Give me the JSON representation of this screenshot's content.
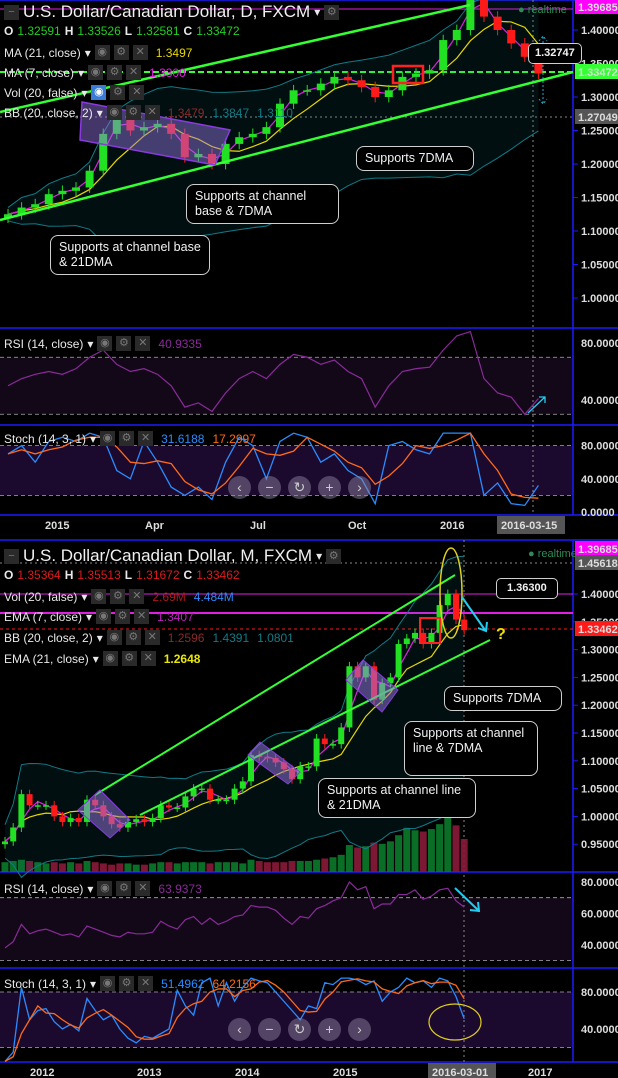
{
  "colors": {
    "up": "#22e022",
    "down": "#ff1a1a",
    "ma21": "#e8d800",
    "ma7": "#e020e0",
    "bb": "#117a86",
    "channel": "#33ff33",
    "axis": "#1a1aff",
    "rsi": "#8a2a9a",
    "stoch_k": "#2a8cff",
    "stoch_d": "#ff6a1a",
    "arrow": "#22ccee"
  },
  "daily": {
    "title": "U.S. Dollar/Canadian Dollar, D, FXCM",
    "ohlc": {
      "o": "1.32591",
      "h": "1.33526",
      "l": "1.32581",
      "c": "1.33472"
    },
    "legend": {
      "ma21": {
        "label": "MA (21, close)",
        "value": "1.3497"
      },
      "ma7": {
        "label": "MA (7, close)",
        "value": "1.3300"
      },
      "vol": {
        "label": "Vol (20, false)"
      },
      "bb": {
        "label": "BB (20, close, 2)",
        "v1": "1.3479",
        "v2": "1.3847",
        "v3": "1.3110"
      },
      "rsi": {
        "label": "RSI (14, close)",
        "value": "40.9335"
      },
      "stoch": {
        "label": "Stoch (14, 3, 1)",
        "k": "31.6188",
        "d": "17.2997"
      }
    },
    "realtime": "realtime",
    "price_axis": [
      "1.40000",
      "1.35000",
      "1.30000",
      "1.25000",
      "1.20000",
      "1.15000",
      "1.10000",
      "1.05000",
      "1.00000"
    ],
    "price_tags": {
      "high": "1.39685",
      "last": "1.33472",
      "cross": "1.27049",
      "callout": "1.32747"
    },
    "rsi_axis": [
      "80.0000",
      "40.0000"
    ],
    "stoch_axis": [
      "80.0000",
      "40.0000",
      "0.0000"
    ],
    "time_axis": [
      "2015",
      "Apr",
      "Jul",
      "Oct",
      "2016"
    ],
    "cursor_date": "2016-03-15",
    "annotations": [
      "Supports at channel base & 21DMA",
      "Supports at channel base & 7DMA",
      "Supports 7DMA"
    ],
    "chart_data": {
      "type": "candlestick",
      "closes": [
        1.125,
        1.135,
        1.14,
        1.155,
        1.16,
        1.165,
        1.19,
        1.245,
        1.27,
        1.25,
        1.255,
        1.26,
        1.245,
        1.21,
        1.215,
        1.2,
        1.23,
        1.24,
        1.245,
        1.255,
        1.29,
        1.31,
        1.31,
        1.32,
        1.33,
        1.325,
        1.315,
        1.3,
        1.31,
        1.33,
        1.335,
        1.34,
        1.385,
        1.4,
        1.46,
        1.42,
        1.4,
        1.38,
        1.36,
        1.335
      ],
      "rsi": [
        50,
        55,
        58,
        60,
        58,
        62,
        70,
        75,
        65,
        60,
        62,
        58,
        50,
        35,
        38,
        32,
        45,
        55,
        60,
        55,
        65,
        72,
        70,
        65,
        68,
        60,
        55,
        35,
        50,
        60,
        62,
        63,
        75,
        85,
        88,
        55,
        45,
        42,
        30,
        41
      ],
      "stoch_k": [
        70,
        80,
        60,
        85,
        90,
        85,
        95,
        90,
        50,
        40,
        85,
        60,
        30,
        20,
        30,
        15,
        60,
        90,
        80,
        40,
        85,
        95,
        90,
        60,
        70,
        50,
        40,
        10,
        80,
        85,
        75,
        70,
        95,
        95,
        95,
        20,
        35,
        10,
        8,
        32
      ],
      "ylim": [
        0.97,
        1.45
      ]
    }
  },
  "monthly": {
    "title": "U.S. Dollar/Canadian Dollar, M, FXCM",
    "ohlc": {
      "o": "1.35364",
      "h": "1.35513",
      "l": "1.31672",
      "c": "1.33462"
    },
    "legend": {
      "vol": {
        "label": "Vol (20, false)",
        "v1": "2.69M",
        "v2": "4.484M"
      },
      "ema7": {
        "label": "EMA (7, close)",
        "value": "1.3407"
      },
      "bb": {
        "label": "BB (20, close, 2)",
        "v1": "1.2596",
        "v2": "1.4391",
        "v3": "1.0801"
      },
      "ema21": {
        "label": "EMA (21, close)",
        "value": "1.2648"
      },
      "rsi": {
        "label": "RSI (14, close)",
        "value": "63.9373"
      },
      "stoch": {
        "label": "Stoch (14, 3, 1)",
        "k": "51.4962",
        "d": "64.2156"
      }
    },
    "realtime": "realtime",
    "price_axis": [
      "1.40000",
      "1.35000",
      "1.30000",
      "1.25000",
      "1.20000",
      "1.15000",
      "1.10000",
      "1.05000",
      "1.00000",
      "0.95000"
    ],
    "price_tags": {
      "high": "1.39685",
      "cross": "1.45618",
      "last": "1.33462",
      "callout": "1.36300"
    },
    "rsi_axis": [
      "80.0000",
      "60.0000",
      "40.0000"
    ],
    "stoch_axis": [
      "80.0000",
      "40.0000"
    ],
    "time_axis": [
      "2012",
      "2013",
      "2014",
      "2015",
      "2017"
    ],
    "cursor_date": "2016-03-01",
    "question": "?",
    "annotations": [
      "Supports 7DMA",
      "Supports at channel line & 7DMA",
      "Supports at channel line & 21DMA"
    ],
    "chart_data": {
      "type": "candlestick",
      "closes": [
        0.955,
        0.98,
        1.04,
        1.02,
        1.02,
        1.02,
        1.0,
        0.99,
        0.997,
        0.99,
        1.03,
        1.02,
        1.0,
        0.986,
        0.98,
        0.99,
        0.995,
        0.99,
        0.997,
        1.02,
        1.016,
        1.016,
        1.036,
        1.05,
        1.05,
        1.03,
        1.03,
        1.03,
        1.05,
        1.063,
        1.11,
        1.107,
        1.105,
        1.097,
        1.085,
        1.067,
        1.09,
        1.09,
        1.14,
        1.13,
        1.13,
        1.16,
        1.27,
        1.25,
        1.27,
        1.21,
        1.24,
        1.25,
        1.31,
        1.32,
        1.33,
        1.31,
        1.33,
        1.38,
        1.4,
        1.354,
        1.335
      ],
      "volume": [
        0.8,
        0.9,
        1.0,
        0.9,
        0.8,
        0.7,
        0.8,
        0.7,
        0.8,
        0.7,
        0.9,
        0.8,
        0.7,
        0.6,
        0.7,
        0.7,
        0.6,
        0.6,
        0.7,
        0.8,
        0.8,
        0.7,
        0.8,
        0.8,
        0.8,
        0.7,
        0.8,
        0.8,
        0.8,
        0.7,
        1.0,
        0.9,
        0.8,
        0.8,
        0.8,
        0.9,
        0.9,
        0.9,
        1.0,
        1.1,
        1.2,
        1.4,
        2.2,
        2.0,
        2.1,
        2.4,
        2.3,
        2.5,
        3.0,
        3.6,
        3.4,
        3.3,
        3.5,
        3.9,
        4.484,
        3.8,
        2.69
      ],
      "rsi": [
        38,
        42,
        53,
        47,
        49,
        50,
        48,
        46,
        47,
        45,
        52,
        50,
        48,
        46,
        45,
        48,
        47,
        47,
        48,
        55,
        52,
        50,
        56,
        58,
        53,
        57,
        53,
        55,
        58,
        59,
        65,
        64,
        64,
        62,
        57,
        53,
        58,
        57,
        63,
        65,
        68,
        70,
        80,
        75,
        77,
        63,
        66,
        66,
        72,
        72,
        75,
        69,
        71,
        75,
        76,
        68,
        64
      ],
      "stoch_k": [
        5,
        15,
        85,
        50,
        60,
        62,
        48,
        40,
        45,
        38,
        73,
        60,
        50,
        55,
        40,
        30,
        25,
        32,
        30,
        35,
        40,
        82,
        65,
        55,
        90,
        95,
        65,
        90,
        70,
        85,
        95,
        92,
        90,
        80,
        70,
        60,
        50,
        65,
        62,
        90,
        88,
        95,
        95,
        93,
        88,
        92,
        70,
        80,
        85,
        95,
        90,
        92,
        85,
        95,
        92,
        75,
        51
      ],
      "ylim": [
        0.92,
        1.46
      ]
    }
  }
}
